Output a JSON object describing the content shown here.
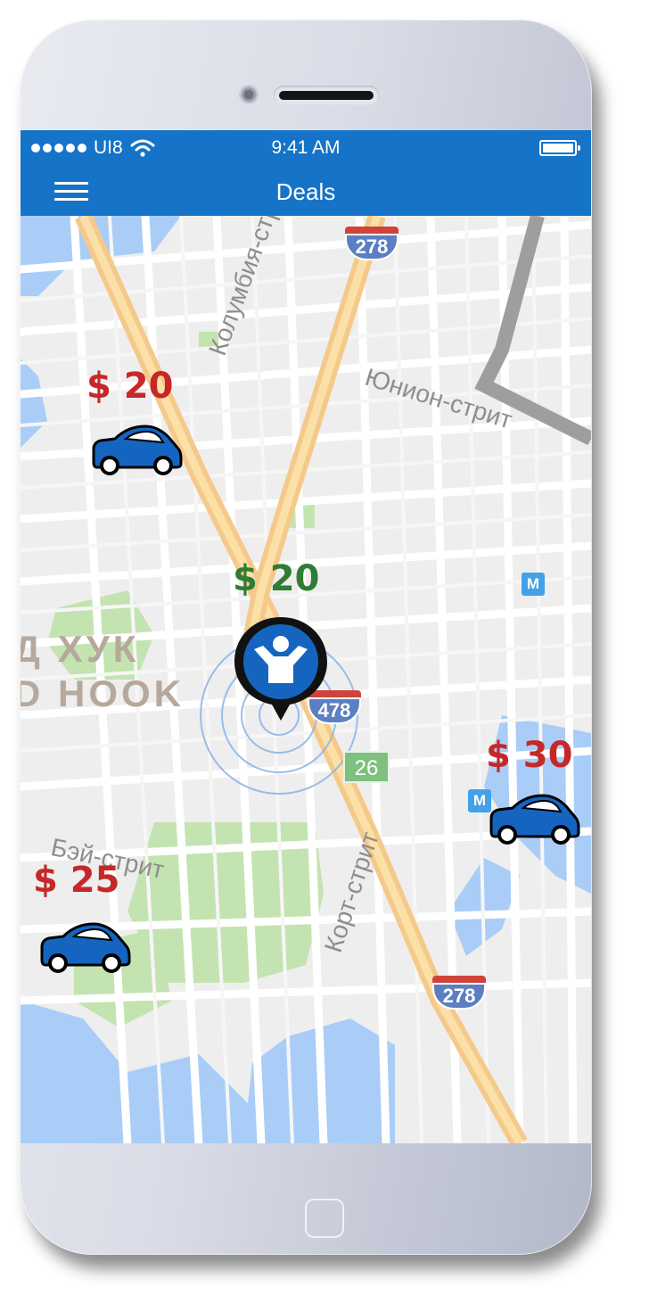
{
  "status_bar": {
    "carrier": "UI8",
    "time": "9:41 AM"
  },
  "nav": {
    "title": "Deals"
  },
  "map": {
    "street_labels": [
      "Колумбия-стрит",
      "Юнион-стрит",
      "Корт-стрит",
      "Бэй-стрит"
    ],
    "place_labels": [
      "Д ХУК",
      "D HOOK"
    ],
    "highway_shields": [
      "278",
      "478",
      "278"
    ],
    "route_marker": "26",
    "metro_marker": "M"
  },
  "deals": [
    {
      "price": "$ 20",
      "color": "#c62828",
      "kind": "car"
    },
    {
      "price": "$ 20",
      "color": "#2e7d32",
      "kind": "user"
    },
    {
      "price": "$ 30",
      "color": "#c62828",
      "kind": "car"
    },
    {
      "price": "$ 25",
      "color": "#c62828",
      "kind": "car"
    }
  ],
  "colors": {
    "accent": "#1574c8",
    "car": "#1565c0",
    "price_red": "#c62828",
    "price_green": "#2e7d32"
  },
  "icons": {
    "menu": "hamburger-icon",
    "wifi": "wifi-icon",
    "battery": "battery-icon",
    "user_pin": "user-location-pin-icon",
    "car": "car-icon"
  }
}
